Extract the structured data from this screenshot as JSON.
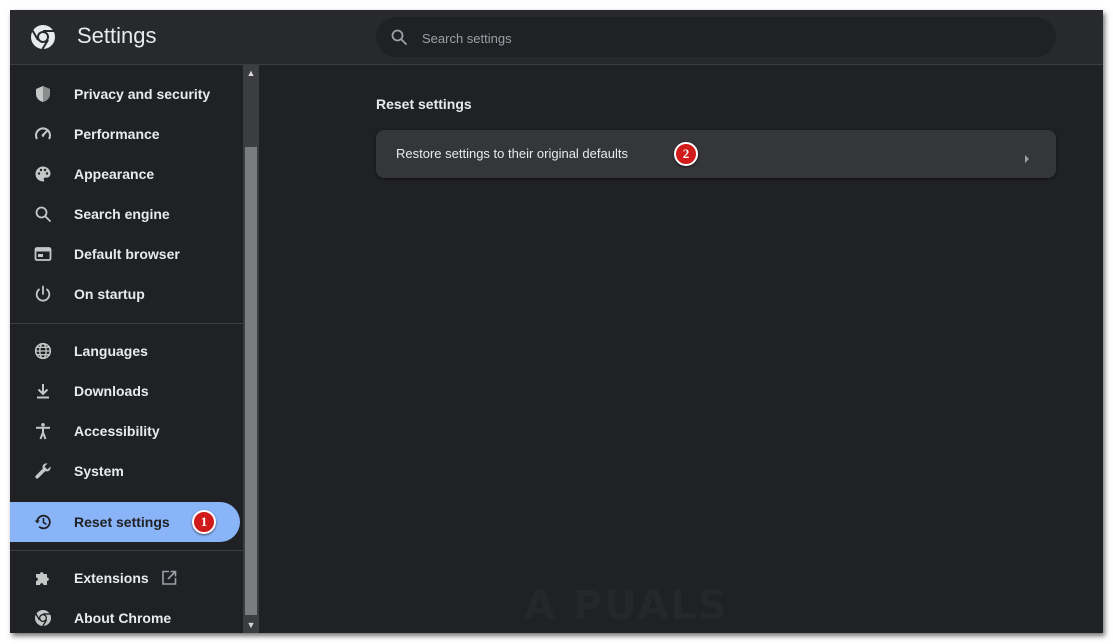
{
  "app": {
    "title": "Settings"
  },
  "search": {
    "placeholder": "Search settings"
  },
  "sidebar": {
    "items": [
      {
        "label": "Privacy and security",
        "icon": "shield-icon"
      },
      {
        "label": "Performance",
        "icon": "speedometer-icon"
      },
      {
        "label": "Appearance",
        "icon": "palette-icon"
      },
      {
        "label": "Search engine",
        "icon": "search-icon"
      },
      {
        "label": "Default browser",
        "icon": "browser-window-icon"
      },
      {
        "label": "On startup",
        "icon": "power-icon"
      },
      {
        "label": "Languages",
        "icon": "globe-icon"
      },
      {
        "label": "Downloads",
        "icon": "download-icon"
      },
      {
        "label": "Accessibility",
        "icon": "accessibility-icon"
      },
      {
        "label": "System",
        "icon": "wrench-icon"
      },
      {
        "label": "Reset settings",
        "icon": "restore-history-icon",
        "active": true
      },
      {
        "label": "Extensions",
        "icon": "puzzle-icon"
      },
      {
        "label": "About Chrome",
        "icon": "chrome-icon"
      }
    ]
  },
  "annotations": {
    "step1": "1",
    "step2": "2"
  },
  "main": {
    "section_title": "Reset settings",
    "restore_row": {
      "label": "Restore settings to their original defaults"
    }
  },
  "watermark": {
    "text": "A PUALS"
  },
  "colors": {
    "background": "#202124",
    "header": "#28292c",
    "active_item": "#8ab4f8",
    "card": "#35363a",
    "text": "#e8eaed",
    "badge": "#d11a1a"
  }
}
